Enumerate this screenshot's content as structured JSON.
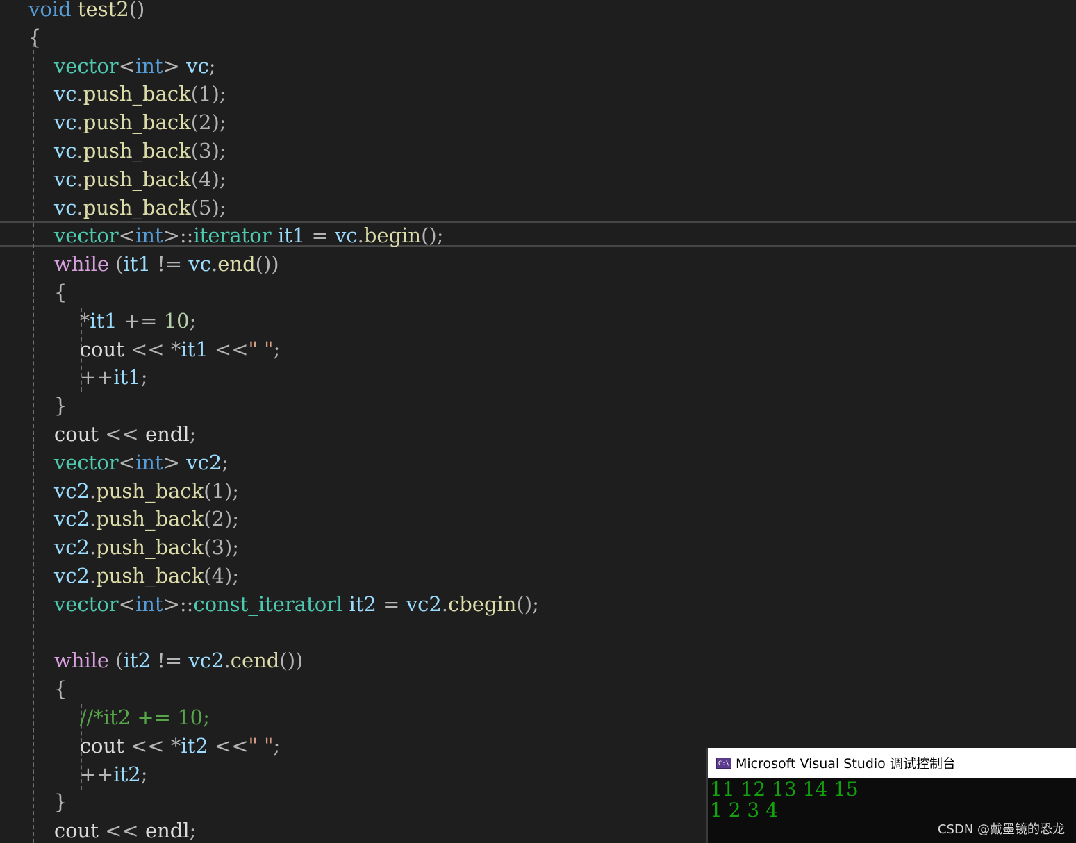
{
  "editor": {
    "lines": [
      [
        {
          "t": "void",
          "c": "kw"
        },
        {
          "t": " test2",
          "c": "fn"
        },
        {
          "t": "()",
          "c": "op"
        }
      ],
      [
        {
          "t": "{",
          "c": "op"
        }
      ],
      [
        {
          "t": "    vector",
          "c": "type"
        },
        {
          "t": "<",
          "c": "op"
        },
        {
          "t": "int",
          "c": "kw"
        },
        {
          "t": ">",
          "c": "op"
        },
        {
          "t": " vc",
          "c": "var"
        },
        {
          "t": ";",
          "c": "op"
        }
      ],
      [
        {
          "t": "    vc",
          "c": "var"
        },
        {
          "t": ".",
          "c": "op"
        },
        {
          "t": "push_back",
          "c": "fn"
        },
        {
          "t": "(1);",
          "c": "op"
        }
      ],
      [
        {
          "t": "    vc",
          "c": "var"
        },
        {
          "t": ".",
          "c": "op"
        },
        {
          "t": "push_back",
          "c": "fn"
        },
        {
          "t": "(2);",
          "c": "op"
        }
      ],
      [
        {
          "t": "    vc",
          "c": "var"
        },
        {
          "t": ".",
          "c": "op"
        },
        {
          "t": "push_back",
          "c": "fn"
        },
        {
          "t": "(3);",
          "c": "op"
        }
      ],
      [
        {
          "t": "    vc",
          "c": "var"
        },
        {
          "t": ".",
          "c": "op"
        },
        {
          "t": "push_back",
          "c": "fn"
        },
        {
          "t": "(4);",
          "c": "op"
        }
      ],
      [
        {
          "t": "    vc",
          "c": "var"
        },
        {
          "t": ".",
          "c": "op"
        },
        {
          "t": "push_back",
          "c": "fn"
        },
        {
          "t": "(5);",
          "c": "op"
        }
      ],
      [
        {
          "t": "    vector",
          "c": "type"
        },
        {
          "t": "<",
          "c": "op"
        },
        {
          "t": "int",
          "c": "kw"
        },
        {
          "t": ">::",
          "c": "op"
        },
        {
          "t": "iterator",
          "c": "type"
        },
        {
          "t": " it1",
          "c": "var"
        },
        {
          "t": " = ",
          "c": "op"
        },
        {
          "t": "vc",
          "c": "var"
        },
        {
          "t": ".",
          "c": "op"
        },
        {
          "t": "begin",
          "c": "fn"
        },
        {
          "t": "();",
          "c": "op"
        }
      ],
      [
        {
          "t": "    while",
          "c": "ctl"
        },
        {
          "t": " (",
          "c": "op"
        },
        {
          "t": "it1",
          "c": "var"
        },
        {
          "t": " != ",
          "c": "op"
        },
        {
          "t": "vc",
          "c": "var"
        },
        {
          "t": ".",
          "c": "op"
        },
        {
          "t": "end",
          "c": "fn"
        },
        {
          "t": "())",
          "c": "op"
        }
      ],
      [
        {
          "t": "    {",
          "c": "op"
        }
      ],
      [
        {
          "t": "        *",
          "c": "op"
        },
        {
          "t": "it1",
          "c": "var"
        },
        {
          "t": " += ",
          "c": "op"
        },
        {
          "t": "10",
          "c": "num"
        },
        {
          "t": ";",
          "c": "op"
        }
      ],
      [
        {
          "t": "        cout",
          "c": "plain"
        },
        {
          "t": " << *",
          "c": "op"
        },
        {
          "t": "it1",
          "c": "var"
        },
        {
          "t": " <<",
          "c": "op"
        },
        {
          "t": "\" \"",
          "c": "str"
        },
        {
          "t": ";",
          "c": "op"
        }
      ],
      [
        {
          "t": "        ++",
          "c": "op"
        },
        {
          "t": "it1",
          "c": "var"
        },
        {
          "t": ";",
          "c": "op"
        }
      ],
      [
        {
          "t": "    }",
          "c": "op"
        }
      ],
      [
        {
          "t": "    cout",
          "c": "plain"
        },
        {
          "t": " << ",
          "c": "op"
        },
        {
          "t": "endl",
          "c": "plain"
        },
        {
          "t": ";",
          "c": "op"
        }
      ],
      [
        {
          "t": "    vector",
          "c": "type"
        },
        {
          "t": "<",
          "c": "op"
        },
        {
          "t": "int",
          "c": "kw"
        },
        {
          "t": ">",
          "c": "op"
        },
        {
          "t": " vc2",
          "c": "var"
        },
        {
          "t": ";",
          "c": "op"
        }
      ],
      [
        {
          "t": "    vc2",
          "c": "var"
        },
        {
          "t": ".",
          "c": "op"
        },
        {
          "t": "push_back",
          "c": "fn"
        },
        {
          "t": "(1);",
          "c": "op"
        }
      ],
      [
        {
          "t": "    vc2",
          "c": "var"
        },
        {
          "t": ".",
          "c": "op"
        },
        {
          "t": "push_back",
          "c": "fn"
        },
        {
          "t": "(2);",
          "c": "op"
        }
      ],
      [
        {
          "t": "    vc2",
          "c": "var"
        },
        {
          "t": ".",
          "c": "op"
        },
        {
          "t": "push_back",
          "c": "fn"
        },
        {
          "t": "(3);",
          "c": "op"
        }
      ],
      [
        {
          "t": "    vc2",
          "c": "var"
        },
        {
          "t": ".",
          "c": "op"
        },
        {
          "t": "push_back",
          "c": "fn"
        },
        {
          "t": "(4);",
          "c": "op"
        }
      ],
      [
        {
          "t": "    vector",
          "c": "type"
        },
        {
          "t": "<",
          "c": "op"
        },
        {
          "t": "int",
          "c": "kw"
        },
        {
          "t": ">::",
          "c": "op"
        },
        {
          "t": "const_iteratorl",
          "c": "type"
        },
        {
          "t": " it2",
          "c": "var"
        },
        {
          "t": " = ",
          "c": "op"
        },
        {
          "t": "vc2",
          "c": "var"
        },
        {
          "t": ".",
          "c": "op"
        },
        {
          "t": "cbegin",
          "c": "fn"
        },
        {
          "t": "();",
          "c": "op"
        }
      ],
      [],
      [
        {
          "t": "    while",
          "c": "ctl"
        },
        {
          "t": " (",
          "c": "op"
        },
        {
          "t": "it2",
          "c": "var"
        },
        {
          "t": " != ",
          "c": "op"
        },
        {
          "t": "vc2",
          "c": "var"
        },
        {
          "t": ".",
          "c": "op"
        },
        {
          "t": "cend",
          "c": "fn"
        },
        {
          "t": "())",
          "c": "op"
        }
      ],
      [
        {
          "t": "    {",
          "c": "op"
        }
      ],
      [
        {
          "t": "        //*it2 += 10;",
          "c": "cmt"
        }
      ],
      [
        {
          "t": "        cout",
          "c": "plain"
        },
        {
          "t": " << *",
          "c": "op"
        },
        {
          "t": "it2",
          "c": "var"
        },
        {
          "t": " <<",
          "c": "op"
        },
        {
          "t": "\" \"",
          "c": "str"
        },
        {
          "t": ";",
          "c": "op"
        }
      ],
      [
        {
          "t": "        ++",
          "c": "op"
        },
        {
          "t": "it2",
          "c": "var"
        },
        {
          "t": ";",
          "c": "op"
        }
      ],
      [
        {
          "t": "    }",
          "c": "op"
        }
      ],
      [
        {
          "t": "    cout",
          "c": "plain"
        },
        {
          "t": " << ",
          "c": "op"
        },
        {
          "t": "endl",
          "c": "plain"
        },
        {
          "t": ";",
          "c": "op"
        }
      ]
    ]
  },
  "console": {
    "title": "Microsoft Visual Studio 调试控制台",
    "icon": "C:\\",
    "icon_name": "console-app-icon",
    "output_line_1": "11 12 13 14 15",
    "output_line_2": "1 2 3 4"
  },
  "watermark": "CSDN @戴墨镜的恐龙",
  "colors": {
    "background": "#1e1e1e",
    "keyword": "#569cd6",
    "control": "#d8a0df",
    "type": "#4ec9b0",
    "variable": "#9cdcfe",
    "function": "#dcdcaa",
    "number": "#b5cea8",
    "string": "#d69d85",
    "comment": "#57a64a",
    "console_text": "#13a10e"
  }
}
